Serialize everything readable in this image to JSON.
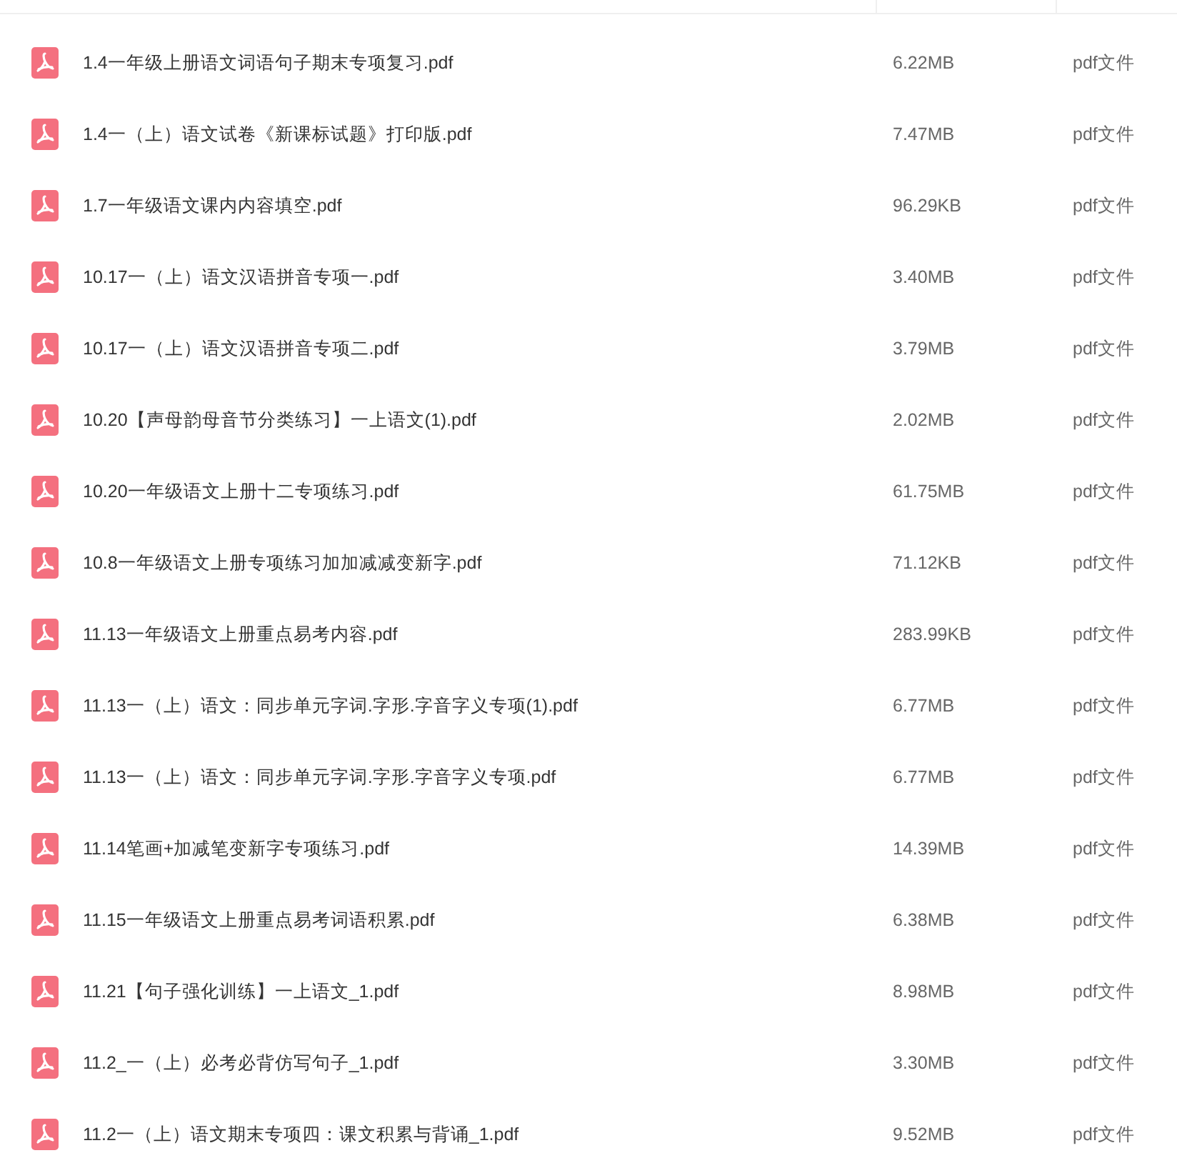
{
  "files": [
    {
      "name": "1.4一年级上册语文词语句子期末专项复习.pdf",
      "size": "6.22MB",
      "type": "pdf文件"
    },
    {
      "name": "1.4一（上）语文试卷《新课标试题》打印版.pdf",
      "size": "7.47MB",
      "type": "pdf文件"
    },
    {
      "name": "1.7一年级语文课内内容填空.pdf",
      "size": "96.29KB",
      "type": "pdf文件"
    },
    {
      "name": "10.17一（上）语文汉语拼音专项一.pdf",
      "size": "3.40MB",
      "type": "pdf文件"
    },
    {
      "name": "10.17一（上）语文汉语拼音专项二.pdf",
      "size": "3.79MB",
      "type": "pdf文件"
    },
    {
      "name": "10.20【声母韵母音节分类练习】一上语文(1).pdf",
      "size": "2.02MB",
      "type": "pdf文件"
    },
    {
      "name": "10.20一年级语文上册十二专项练习.pdf",
      "size": "61.75MB",
      "type": "pdf文件"
    },
    {
      "name": "10.8一年级语文上册专项练习加加减减变新字.pdf",
      "size": "71.12KB",
      "type": "pdf文件"
    },
    {
      "name": "11.13一年级语文上册重点易考内容.pdf",
      "size": "283.99KB",
      "type": "pdf文件"
    },
    {
      "name": "11.13一（上）语文：同步单元字词.字形.字音字义专项(1).pdf",
      "size": "6.77MB",
      "type": "pdf文件"
    },
    {
      "name": "11.13一（上）语文：同步单元字词.字形.字音字义专项.pdf",
      "size": "6.77MB",
      "type": "pdf文件"
    },
    {
      "name": "11.14笔画+加减笔变新字专项练习.pdf",
      "size": "14.39MB",
      "type": "pdf文件"
    },
    {
      "name": "11.15一年级语文上册重点易考词语积累.pdf",
      "size": "6.38MB",
      "type": "pdf文件"
    },
    {
      "name": "11.21【句子强化训练】一上语文_1.pdf",
      "size": "8.98MB",
      "type": "pdf文件"
    },
    {
      "name": "11.2_一（上）必考必背仿写句子_1.pdf",
      "size": "3.30MB",
      "type": "pdf文件"
    },
    {
      "name": "11.2一（上）语文期末专项四：课文积累与背诵_1.pdf",
      "size": "9.52MB",
      "type": "pdf文件"
    }
  ]
}
